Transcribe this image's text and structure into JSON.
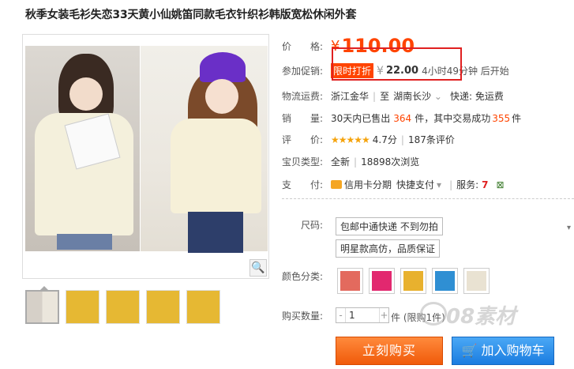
{
  "title": "秋季女装毛衫失恋33天黄小仙姚笛同款毛衣针织衫韩版宽松休闲外套",
  "price": {
    "label": "价　　格:",
    "symbol": "¥",
    "value": "110.00"
  },
  "promo": {
    "label": "参加促销:",
    "tag": "限时打折",
    "symbol": "¥",
    "value": "22.00",
    "time": "4小时49分钟 后开始"
  },
  "shipping": {
    "label": "物流运费:",
    "from": "浙江金华",
    "to_prefix": "至",
    "to": "湖南长沙",
    "to_arrow": "⌄",
    "fee": "快递: 免运费"
  },
  "sales": {
    "label": "销　　量:",
    "prefix": "30天内已售出",
    "sold": "364",
    "mid": "件，其中交易成功",
    "success": "355",
    "unit": "件"
  },
  "rating": {
    "label": "评　　价:",
    "stars": "★★★★★",
    "score": "4.7分",
    "count": "187条评价"
  },
  "type": {
    "label": "宝贝类型:",
    "value": "全新",
    "views": "18898次浏览"
  },
  "payment": {
    "label": "支　　付:",
    "installment": "信用卡分期",
    "express_pay": "快捷支付",
    "express_arrow": "▾",
    "service_label": "服务:",
    "service_icon1": "7",
    "service_icon2": "⊠"
  },
  "size": {
    "label": "尺码:",
    "opt1": "包邮中通快递 不到勿拍",
    "opt2": "明星款高仿，品质保证"
  },
  "color": {
    "label": "颜色分类:",
    "swatches": [
      "#e36a5e",
      "#e2286f",
      "#e8b12e",
      "#2f8fd3",
      "#e9e2d2"
    ]
  },
  "quantity": {
    "label": "购买数量:",
    "minus": "-",
    "value": "1",
    "plus": "+",
    "limit": "件 (限购1件)"
  },
  "buttons": {
    "buy": "立刻购买",
    "cart": "加入购物车",
    "cart_icon": "🛒"
  },
  "watermark": "08素材",
  "zoom_icon": "🔍",
  "side_arrow": "▾"
}
